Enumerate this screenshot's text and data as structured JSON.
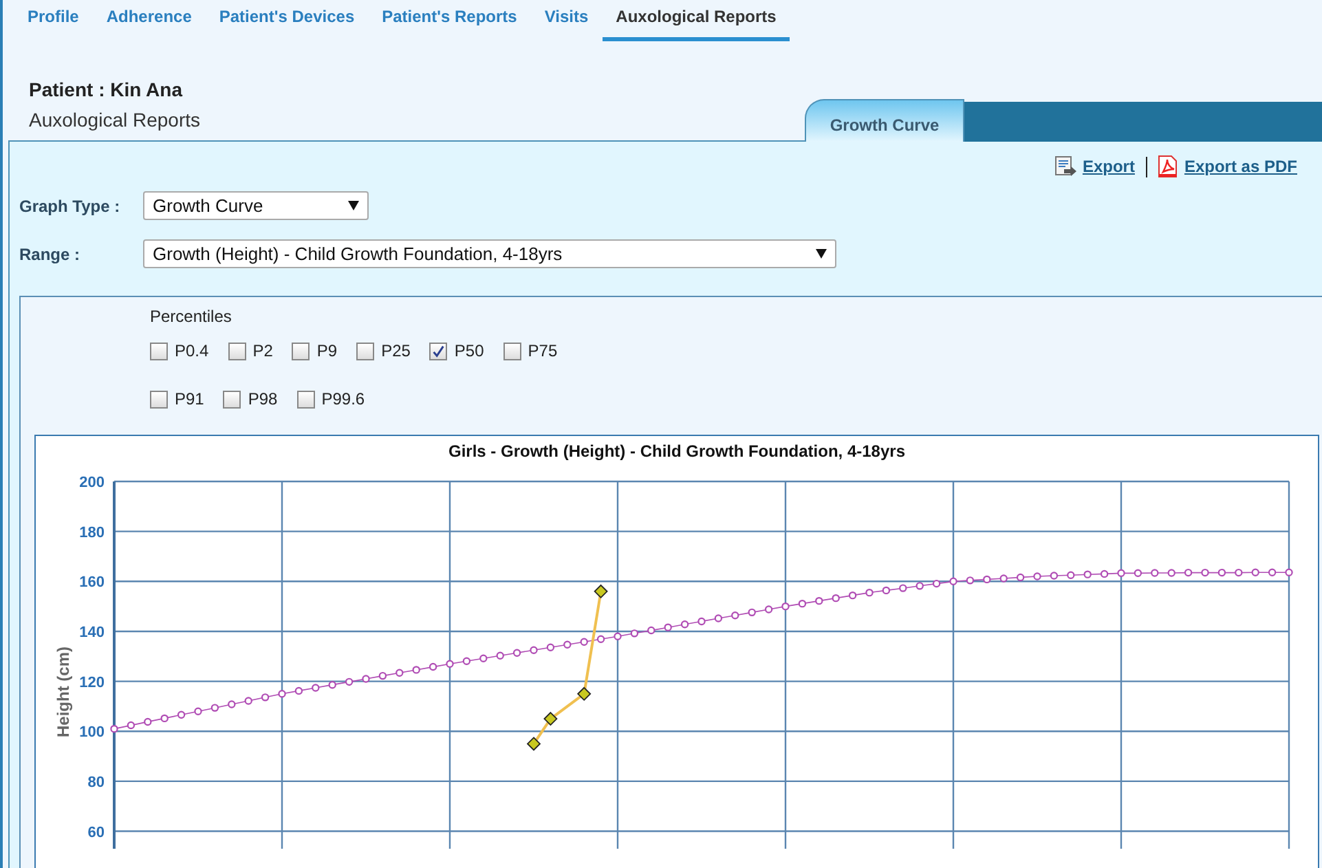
{
  "nav_tabs": [
    {
      "label": "Profile",
      "selected": false
    },
    {
      "label": "Adherence",
      "selected": false
    },
    {
      "label": "Patient's Devices",
      "selected": false
    },
    {
      "label": "Patient's Reports",
      "selected": false
    },
    {
      "label": "Visits",
      "selected": false
    },
    {
      "label": "Auxological Reports",
      "selected": true
    }
  ],
  "patient_title": "Patient : Kin Ana",
  "page_subtitle": "Auxological Reports",
  "panel_tabs": [
    {
      "label": "Growth Curve",
      "selected": true
    }
  ],
  "export_links": [
    "Export",
    "Export as PDF"
  ],
  "form": [
    {
      "label": "Graph Type :",
      "value": "Growth Curve"
    },
    {
      "label": "Range :",
      "value": "Growth (Height) - Child Growth Foundation, 4-18yrs"
    }
  ],
  "percentiles": {
    "title": "Percentiles",
    "rows": [
      [
        {
          "label": "P0.4",
          "checked": false
        },
        {
          "label": "P2",
          "checked": false
        },
        {
          "label": "P9",
          "checked": false
        },
        {
          "label": "P25",
          "checked": false
        },
        {
          "label": "P50",
          "checked": true
        },
        {
          "label": "P75",
          "checked": false
        }
      ],
      [
        {
          "label": "P91",
          "checked": false
        },
        {
          "label": "P98",
          "checked": false
        },
        {
          "label": "P99.6",
          "checked": false
        }
      ]
    ]
  },
  "chart_data": {
    "type": "line",
    "title": "Girls - Growth (Height) - Child Growth Foundation, 4-18yrs",
    "ylabel": "Height (cm)",
    "ylim": [
      53,
      200
    ],
    "grid": true,
    "yticks": [
      60,
      80,
      100,
      120,
      140,
      160,
      180,
      200
    ],
    "categories": [
      null,
      null,
      null,
      null,
      null,
      null,
      null,
      null,
      null,
      null,
      null,
      null,
      null,
      null,
      null,
      null,
      null,
      null,
      null,
      null,
      null,
      null,
      null,
      null,
      null,
      null,
      null,
      null,
      null,
      null,
      null,
      null,
      null,
      null,
      null,
      null,
      null,
      null,
      null,
      null,
      null,
      null,
      null,
      null,
      null,
      null,
      null,
      null,
      null,
      null,
      null,
      null,
      null,
      null,
      null,
      null,
      null,
      null,
      null,
      null,
      null,
      null,
      null,
      null,
      null,
      null,
      null,
      null,
      null,
      null,
      null
    ],
    "series": [
      {
        "color": "#b04cb4",
        "marker": "circle",
        "values": [
          101,
          102.4,
          103.8,
          105.2,
          106.6,
          108,
          109.4,
          110.8,
          112.2,
          113.6,
          115,
          116.2,
          117.4,
          118.6,
          119.8,
          121,
          122.2,
          123.4,
          124.6,
          125.8,
          127,
          128.1,
          129.2,
          130.3,
          131.4,
          132.5,
          133.6,
          134.7,
          135.8,
          136.9,
          138,
          139.2,
          140.4,
          141.6,
          142.8,
          144,
          145.2,
          146.4,
          147.6,
          148.8,
          150,
          151.1,
          152.2,
          153.3,
          154.4,
          155.5,
          156.4,
          157.3,
          158.2,
          159.1,
          160,
          160.4,
          160.8,
          161.2,
          161.6,
          162,
          162.3,
          162.5,
          162.8,
          163,
          163.3,
          163.3,
          163.4,
          163.4,
          163.5,
          163.5,
          163.5,
          163.5,
          163.6,
          163.6,
          163.6
        ]
      },
      {
        "color": "#f0c050",
        "marker": "diamond",
        "values": [
          null,
          null,
          null,
          null,
          null,
          null,
          null,
          null,
          null,
          null,
          null,
          null,
          null,
          null,
          null,
          null,
          null,
          null,
          null,
          null,
          null,
          null,
          null,
          null,
          null,
          95,
          105,
          null,
          115,
          156,
          null,
          null,
          null,
          null,
          null,
          null,
          null,
          null,
          null,
          null,
          null,
          null,
          null,
          null,
          null,
          null,
          null,
          null,
          null,
          null,
          null,
          null,
          null,
          null,
          null,
          null,
          null,
          null,
          null,
          null,
          null,
          null,
          null,
          null,
          null,
          null,
          null,
          null,
          null,
          null,
          null
        ]
      }
    ]
  }
}
